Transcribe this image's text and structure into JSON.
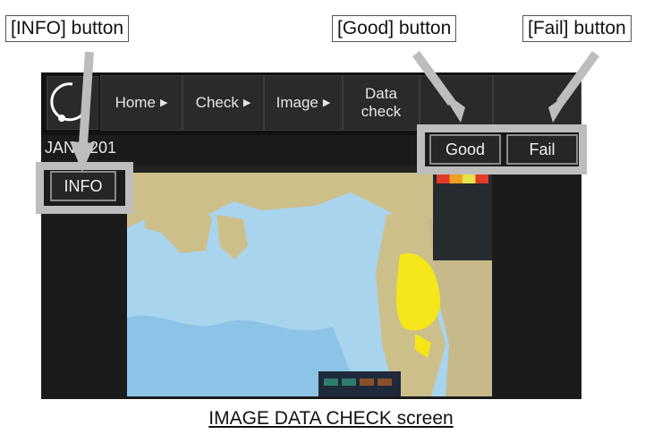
{
  "callouts": {
    "info": "[INFO] button",
    "good": "[Good] button",
    "fail": "[Fail] button"
  },
  "screen": {
    "menu": [
      {
        "label": "Home",
        "arrow": "▶"
      },
      {
        "label": "Check",
        "arrow": "▶"
      },
      {
        "label": "Image",
        "arrow": "▶"
      },
      {
        "label": "Data check",
        "arrow": ""
      }
    ],
    "identifier": "JAN-9201",
    "buttons": {
      "info": "INFO",
      "good": "Good",
      "fail": "Fail"
    }
  },
  "caption": "IMAGE DATA CHECK screen",
  "colors": {
    "frame": "#bdbdbd",
    "background": "#1b1b1b",
    "sea": "#a8d4ee",
    "land": "#cdbf8a",
    "highlight": "#f5e61a"
  }
}
